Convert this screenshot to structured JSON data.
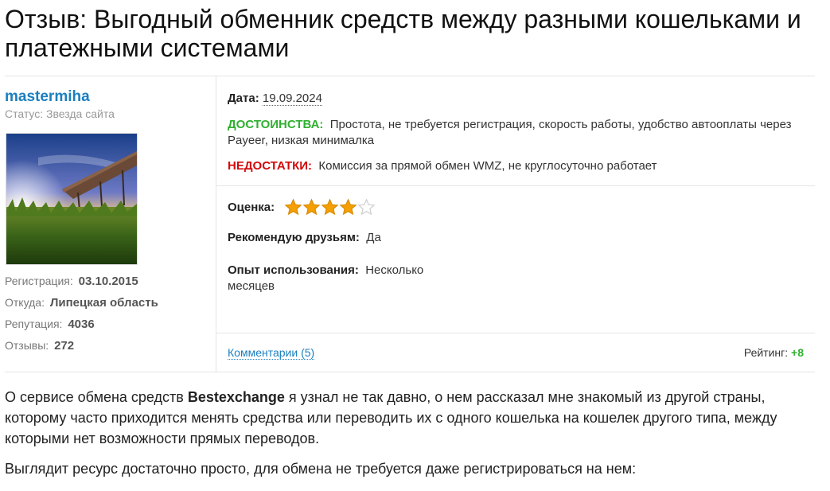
{
  "page": {
    "title": "Отзыв: Выгодный обменник средств между разными кошельками и платежными системами"
  },
  "author": {
    "username": "mastermiha",
    "status": "Статус: Звезда сайта",
    "stats": [
      {
        "label": "Регистрация:",
        "value": "03.10.2015"
      },
      {
        "label": "Откуда:",
        "value": "Липецкая область"
      },
      {
        "label": "Репутация:",
        "value": "4036"
      },
      {
        "label": "Отзывы:",
        "value": "272"
      }
    ]
  },
  "review": {
    "date_label": "Дата:",
    "date": "19.09.2024",
    "pros_label": "ДОСТОИНСТВА:",
    "pros": "Простота, не требуется регистрация, скорость работы, удобство автооплаты через Payeer, низкая минималка",
    "cons_label": "НЕДОСТАТКИ:",
    "cons": "Комиссия за прямой обмен WMZ, не круглосуточно работает",
    "score_label": "Оценка:",
    "score": 4,
    "score_max": 5,
    "recommend_label": "Рекомендую друзьям:",
    "recommend": "Да",
    "experience_label": "Опыт использования:",
    "experience": "Несколько месяцев",
    "comments_link": "Комментарии (5)",
    "rating_label": "Рейтинг:",
    "rating_value": "+8"
  },
  "body": {
    "p1_before": "О сервисе обмена средств ",
    "p1_bold": "Bestexchange",
    "p1_after": " я узнал не так давно, о нем рассказал мне знакомый из другой страны, которому часто приходится менять средства или переводить их с одного кошелька на кошелек другого типа, между которыми нет возможности прямых переводов.",
    "p2": "Выглядит ресурс достаточно просто, для обмена не требуется даже регистрироваться на нем:"
  },
  "colors": {
    "link": "#1a7fbf",
    "pros": "#2fb02f",
    "cons": "#d30a0a",
    "star_on": "#f5a000",
    "star_off": "#cccccc"
  }
}
